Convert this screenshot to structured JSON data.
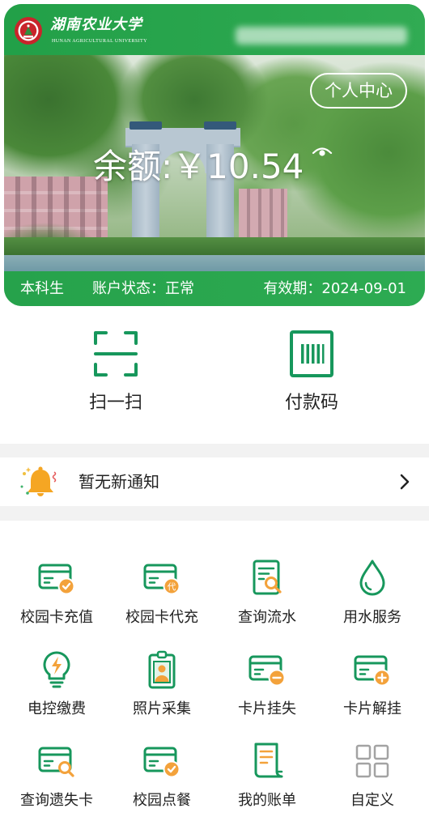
{
  "colors": {
    "primary": "#25a24b",
    "icon_green": "#17975c",
    "icon_orange": "#f3a23b",
    "icon_gray": "#a3a3a3",
    "text": "#222222",
    "separator": "#f2f2f2"
  },
  "header": {
    "logo_icon": "university-emblem-icon",
    "university_name": "湖南农业大学",
    "university_name_en": "HUNAN AGRICULTURAL UNIVERSITY"
  },
  "card": {
    "profile_button": "个人中心",
    "balance_label": "余额:",
    "balance": "￥10.54",
    "visibility_icon": "eye-icon",
    "user_type": "本科生",
    "status_label": "账户状态：",
    "status": "正常",
    "expiry_label": "有效期：",
    "expiry": "2024-09-01"
  },
  "quick_actions": [
    {
      "label": "扫一扫",
      "icon": "scan-icon"
    },
    {
      "label": "付款码",
      "icon": "barcode-icon"
    }
  ],
  "notice": {
    "icon": "bell-icon",
    "text": "暂无新通知",
    "chevron": "chevron-right-icon"
  },
  "services": [
    {
      "label": "校园卡充值",
      "icon": "card-recharge-icon"
    },
    {
      "label": "校园卡代充",
      "icon": "card-proxy-recharge-icon",
      "badge": "代"
    },
    {
      "label": "查询流水",
      "icon": "transaction-query-icon"
    },
    {
      "label": "用水服务",
      "icon": "water-drop-icon"
    },
    {
      "label": "电控缴费",
      "icon": "lightbulb-icon"
    },
    {
      "label": "照片采集",
      "icon": "photo-badge-icon"
    },
    {
      "label": "卡片挂失",
      "icon": "card-report-loss-icon"
    },
    {
      "label": "卡片解挂",
      "icon": "card-unfreeze-icon"
    },
    {
      "label": "查询遗失卡",
      "icon": "lost-card-search-icon"
    },
    {
      "label": "校园点餐",
      "icon": "card-order-icon"
    },
    {
      "label": "我的账单",
      "icon": "bill-icon"
    },
    {
      "label": "自定义",
      "icon": "customize-grid-icon"
    }
  ]
}
